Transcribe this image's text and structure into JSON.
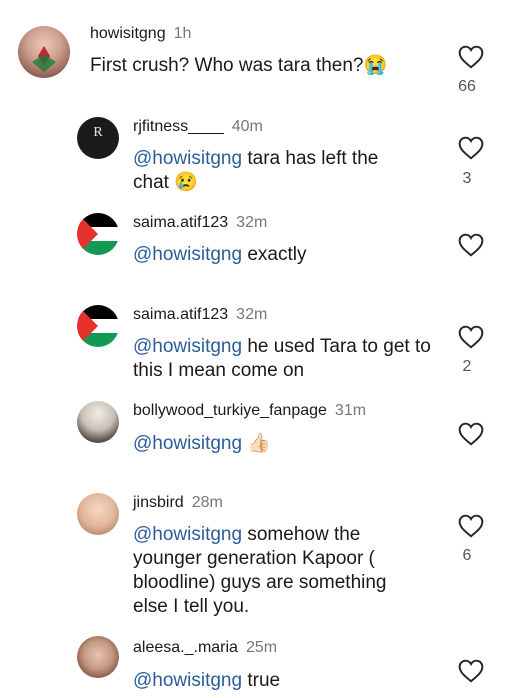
{
  "comments": [
    {
      "user": "howisitgng",
      "time": "1h",
      "mention": "",
      "text": "First crush? Who was tara then?",
      "emoji": "😭",
      "likes": "66"
    },
    {
      "user": "rjfitness____",
      "time": "40m",
      "mention": "@howisitgng",
      "text": "tara has left the chat",
      "emoji": "😢",
      "likes": "3",
      "avatar_text": "R"
    },
    {
      "user": "saima.atif123",
      "time": "32m",
      "mention": "@howisitgng",
      "text": "exactly",
      "emoji": "",
      "likes": ""
    },
    {
      "user": "saima.atif123",
      "time": "32m",
      "mention": "@howisitgng",
      "text": "he used Tara to get to this I mean come on",
      "emoji": "",
      "likes": "2"
    },
    {
      "user": "bollywood_turkiye_fanpage",
      "time": "31m",
      "mention": "@howisitgng",
      "text": "",
      "emoji": "👍🏻",
      "likes": ""
    },
    {
      "user": "jinsbird",
      "time": "28m",
      "mention": "@howisitgng",
      "text": "somehow the younger generation Kapoor ( bloodline) guys are something else I tell you.",
      "emoji": "",
      "likes": "6"
    },
    {
      "user": "aleesa._.maria",
      "time": "25m",
      "mention": "@howisitgng",
      "text": "true",
      "emoji": "",
      "likes": ""
    }
  ],
  "colors": {
    "mention": "#2b5d9a",
    "meta": "#777777",
    "icon": "#262626"
  },
  "icons": {
    "like": "heart-outline-icon"
  }
}
